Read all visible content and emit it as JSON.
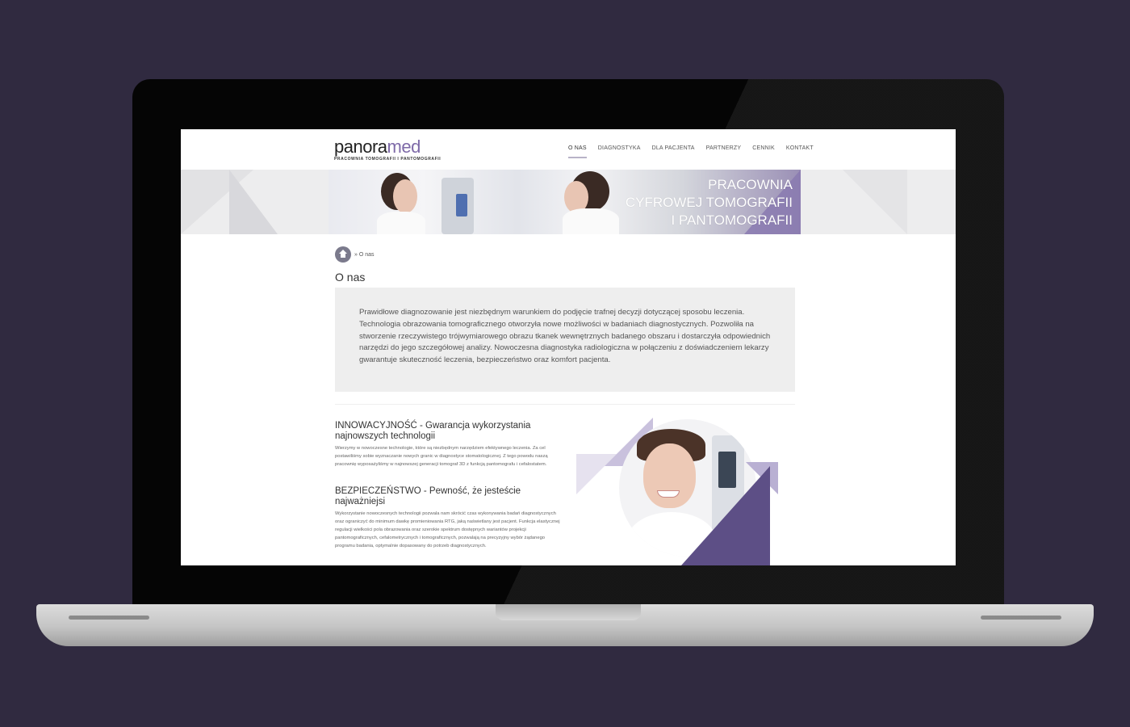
{
  "header": {
    "logo_main": "panora",
    "logo_accent": "med",
    "logo_sub": "PRACOWNIA TOMOGRAFII I PANTOMOGRAFII"
  },
  "nav": {
    "items": [
      {
        "label": "O NAS",
        "active": true
      },
      {
        "label": "DIAGNOSTYKA"
      },
      {
        "label": "DLA PACJENTA"
      },
      {
        "label": "PARTNERZY"
      },
      {
        "label": "CENNIK"
      },
      {
        "label": "KONTAKT"
      }
    ]
  },
  "hero": {
    "line1": "PRACOWNIA",
    "line2": "CYFROWEJ TOMOGRAFII",
    "line3": "I PANTOMOGRAFII"
  },
  "breadcrumb": {
    "text": "» O nas"
  },
  "page": {
    "title": "O nas",
    "intro": "Prawidłowe diagnozowanie jest niezbędnym warunkiem do podjęcie trafnej decyzji dotyczącej sposobu leczenia. Technologia obrazowania tomograficznego otworzyła nowe możliwości w badaniach diagnostycznych. Pozwoliła na stworzenie rzeczywistego trójwymiarowego obrazu tkanek wewnętrznych badanego obszaru i dostarczyła odpowiednich narzędzi do jego szczegółowej analizy. Nowoczesna diagnostyka radiologiczna w połączeniu z doświadczeniem lekarzy gwarantuje skuteczność leczenia, bezpieczeństwo oraz komfort pacjenta."
  },
  "sections": [
    {
      "title": "INNOWACYJNOŚĆ - Gwarancja wykorzystania najnowszych technologii",
      "body": "Wierzymy w nowoczesne technologie, które są niezbędnym narzędziem efektywnego leczenia. Za cel postawiliśmy sobie wyznaczanie nowych granic w diagnostyce stomatologicznej. Z tego powodu naszą pracownię wyposażyliśmy w najnowszej generacji tomograf 3D z funkcją pantomografu i cefalostatem."
    },
    {
      "title": "BEZPIECZEŃSTWO - Pewność, że jesteście najważniejsi",
      "body": "Wykorzystanie nowoczesnych technologii pozwala nam skrócić czas wykonywania badań diagnostycznych oraz ograniczyć do minimum dawkę promieniowania RTG, jaką naświetlany jest pacjent. Funkcja elastycznej regulacji wielkości pola obrazowania oraz szerokie spektrum dostępnych wariantów projekcji pantomograficznych, cefalometrycznych i tomograficznych, pozwalają na precyzyjny wybór żądanego programu badania, optymalnie dopasowany do potrzeb diagnostycznych."
    }
  ],
  "colors": {
    "accent": "#7e6aa8",
    "background": "#302a40",
    "box": "#eeeeee"
  }
}
